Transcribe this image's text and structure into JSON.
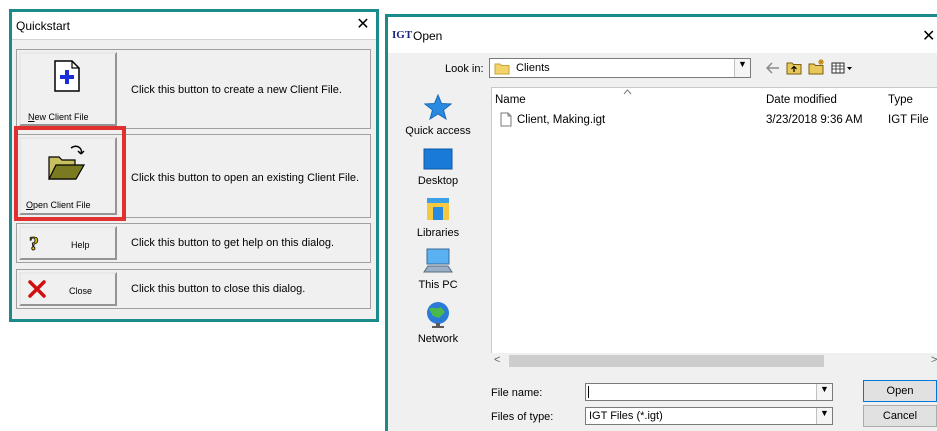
{
  "quickstart": {
    "title": "Quickstart",
    "close_glyph": "✕",
    "rows": [
      {
        "button_label": "New Client File",
        "button_label_underline": "N",
        "button_label_rest": "ew Client File",
        "description": "Click this button to create a new Client File.",
        "icon": "new-file-icon"
      },
      {
        "button_label": "Open Client File",
        "button_label_underline": "O",
        "button_label_rest": "pen Client File",
        "description": "Click this button to open an existing Client File.",
        "icon": "open-folder-icon",
        "highlighted": true,
        "highlight_color": "#e03030"
      },
      {
        "button_label": "Help",
        "description": "Click this button to get help on this dialog.",
        "icon": "help-question-icon"
      },
      {
        "button_label": "Close",
        "description": "Click this button to close this dialog.",
        "icon": "close-x-icon"
      }
    ]
  },
  "open_dialog": {
    "logo": "IGT",
    "title": "Open",
    "close_glyph": "✕",
    "look_in_label": "Look in:",
    "look_in_value": "Clients",
    "places": [
      {
        "label": "Quick access",
        "icon": "star-icon"
      },
      {
        "label": "Desktop",
        "icon": "desktop-icon"
      },
      {
        "label": "Libraries",
        "icon": "libraries-icon"
      },
      {
        "label": "This PC",
        "icon": "computer-icon"
      },
      {
        "label": "Network",
        "icon": "network-icon"
      }
    ],
    "columns": [
      "Name",
      "Date modified",
      "Type"
    ],
    "files": [
      {
        "name": "Client, Making.igt",
        "date_modified": "3/23/2018 9:36 AM",
        "type": "IGT File"
      }
    ],
    "file_name_label": "File name:",
    "file_name_value": "",
    "files_of_type_label": "Files of type:",
    "files_of_type_value": "IGT Files (*.igt)",
    "open_button": "Open",
    "cancel_button": "Cancel"
  },
  "colors": {
    "frame_accent": "#1a8a8a",
    "highlight": "#e03030"
  }
}
